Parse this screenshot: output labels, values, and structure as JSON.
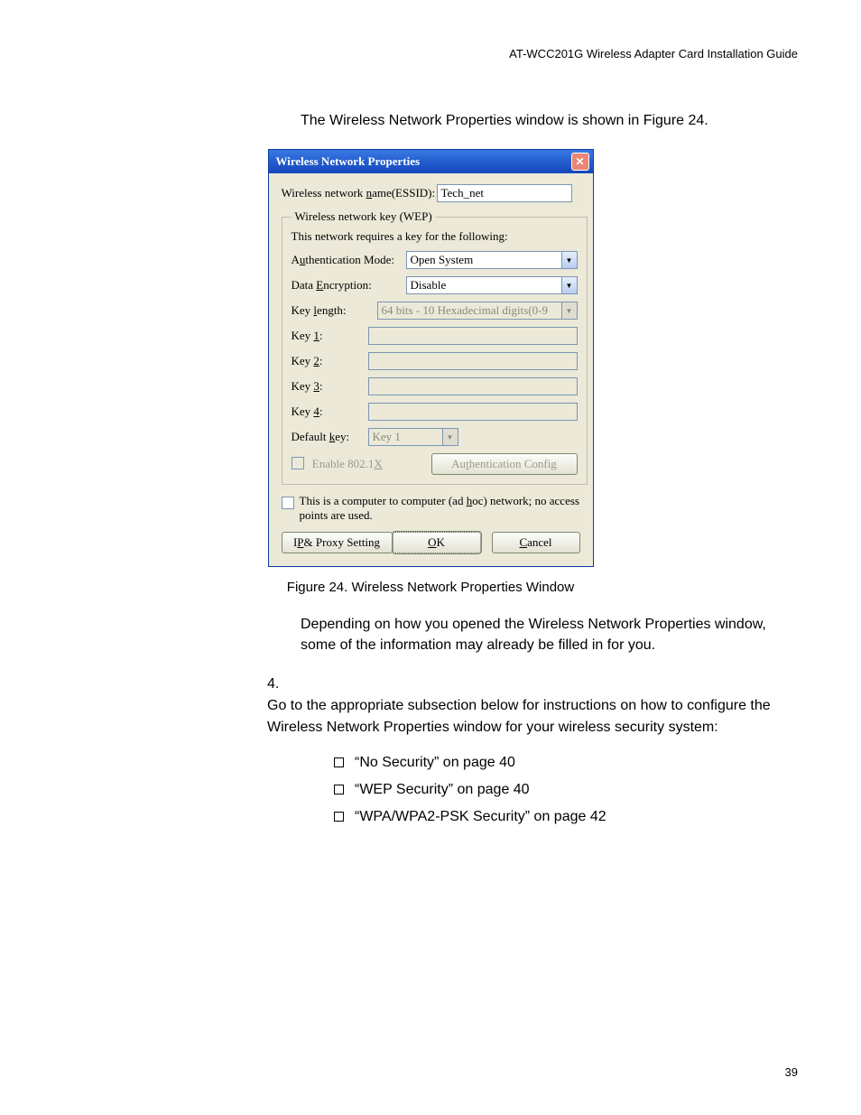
{
  "header": "AT-WCC201G Wireless Adapter Card Installation Guide",
  "intro": "The Wireless Network Properties window is shown in Figure 24.",
  "dialog": {
    "title": "Wireless Network Properties",
    "essid_label": "Wireless network name(ESSID):",
    "essid_value": "Tech_net",
    "wep_legend": "Wireless network key (WEP)",
    "wep_note": "This network requires a key for the following:",
    "auth_label": "Authentication Mode:",
    "auth_value": "Open System",
    "enc_label": "Data Encryption:",
    "enc_value": "Disable",
    "keylen_label": "Key length:",
    "keylen_value": "64 bits - 10 Hexadecimal digits(0-9",
    "key1_label": "Key 1:",
    "key2_label": "Key 2:",
    "key3_label": "Key 3:",
    "key4_label": "Key 4:",
    "defkey_label": "Default key:",
    "defkey_value": "Key 1",
    "enable8021x": "Enable 802.1X",
    "authcfg": "Authentication Config",
    "adhoc": "This is a computer to computer (ad hoc) network; no access points are used.",
    "ipproxy": "IP & Proxy Setting",
    "ok": "OK",
    "cancel": "Cancel"
  },
  "caption": "Figure 24. Wireless Network Properties Window",
  "para2": "Depending on how you opened the Wireless Network Properties window, some of the information may already be filled in for you.",
  "step4_num": "4.",
  "step4": "Go to the appropriate subsection below for instructions on how to configure the Wireless Network Properties window for your wireless security system:",
  "bullets": [
    "“No Security” on page 40",
    "“WEP Security” on page 40",
    "“WPA/WPA2-PSK Security” on page 42"
  ],
  "page_number": "39"
}
